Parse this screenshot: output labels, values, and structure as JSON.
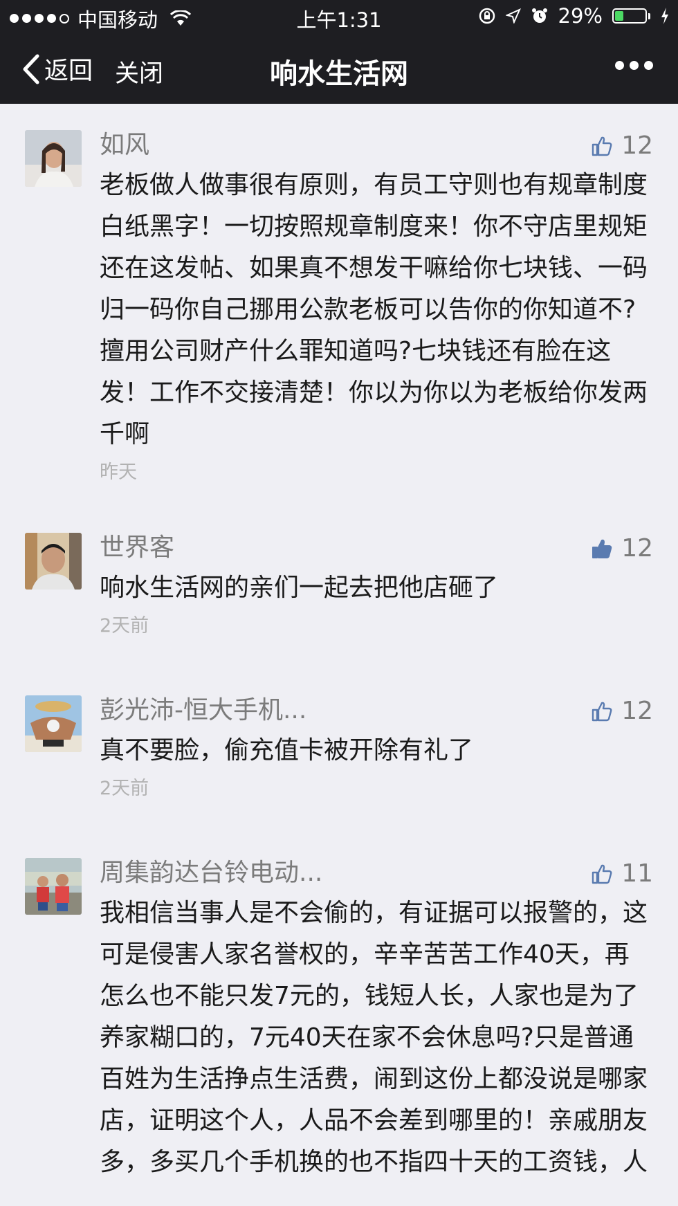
{
  "status": {
    "carrier": "中国移动",
    "time": "上午1:31",
    "battery": "29%",
    "battery_level": 0.29
  },
  "nav": {
    "back_label": "返回",
    "close_label": "关闭",
    "title": "响水生活网"
  },
  "comments": [
    {
      "name": "如风",
      "likes": "12",
      "liked": false,
      "text": "老板做人做事很有原则，有员工守则也有规章制度白纸黑字！一切按照规章制度来！你不守店里规矩还在这发帖、如果真不想发干嘛给你七块钱、一码归一码你自己挪用公款老板可以告你的你知道不?擅用公司财产什么罪知道吗?七块钱还有脸在这发！工作不交接清楚！你以为你以为老板给你发两千啊",
      "time": "昨天"
    },
    {
      "name": "世界客",
      "likes": "12",
      "liked": true,
      "text": "响水生活网的亲们一起去把他店砸了",
      "time": "2天前"
    },
    {
      "name": "彭光沛-恒大手机...",
      "likes": "12",
      "liked": false,
      "text": "真不要脸，偷充值卡被开除有礼了",
      "time": "2天前"
    },
    {
      "name": "周集韵达台铃电动...",
      "likes": "11",
      "liked": false,
      "text": "我相信当事人是不会偷的，有证据可以报警的，这可是侵害人家名誉权的，辛辛苦苦工作40天，再怎么也不能只发7元的，钱短人长，人家也是为了养家糊口的，7元40天在家不会休息吗?只是普通百姓为生活挣点生活费，闹到这份上都没说是哪家店，证明这个人，人品不会差到哪里的！亲戚朋友多，多买几个手机换的也不指四十天的工资钱，人",
      "time": ""
    }
  ],
  "colors": {
    "bar": "#1e1e22",
    "background": "#efeff4",
    "like_blue": "#5a7bb0",
    "battery_green": "#4cd964"
  }
}
